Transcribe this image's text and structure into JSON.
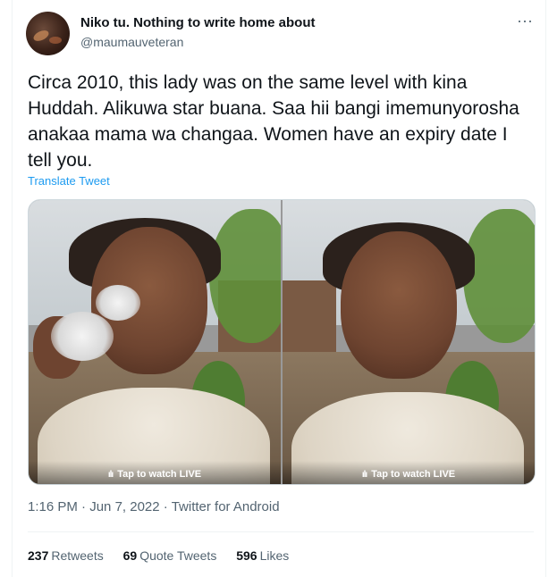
{
  "author": {
    "display_name": "Niko tu. Nothing to write home about",
    "handle": "@maumauveteran"
  },
  "more_icon": "more-horizontal-icon",
  "tweet": {
    "text": "Circa 2010, this lady was on the same level with kina Huddah. Alikuwa star buana. Saa hii bangi imemunyorosha anakaa mama wa changaa. Women have an expiry date I tell you.",
    "translate_label": "Translate Tweet"
  },
  "media": {
    "items": [
      {
        "live_label": "Tap to watch LIVE"
      },
      {
        "live_label": "Tap to watch LIVE"
      }
    ]
  },
  "meta": {
    "time": "1:16 PM",
    "sep1": " · ",
    "date": "Jun 7, 2022",
    "sep2": " · ",
    "source": "Twitter for Android"
  },
  "stats": {
    "retweets_count": "237",
    "retweets_label": "Retweets",
    "quotes_count": "69",
    "quotes_label": "Quote Tweets",
    "likes_count": "596",
    "likes_label": "Likes"
  },
  "colors": {
    "link": "#1d9bf0",
    "secondary_text": "#536471",
    "primary_text": "#0f1419"
  }
}
